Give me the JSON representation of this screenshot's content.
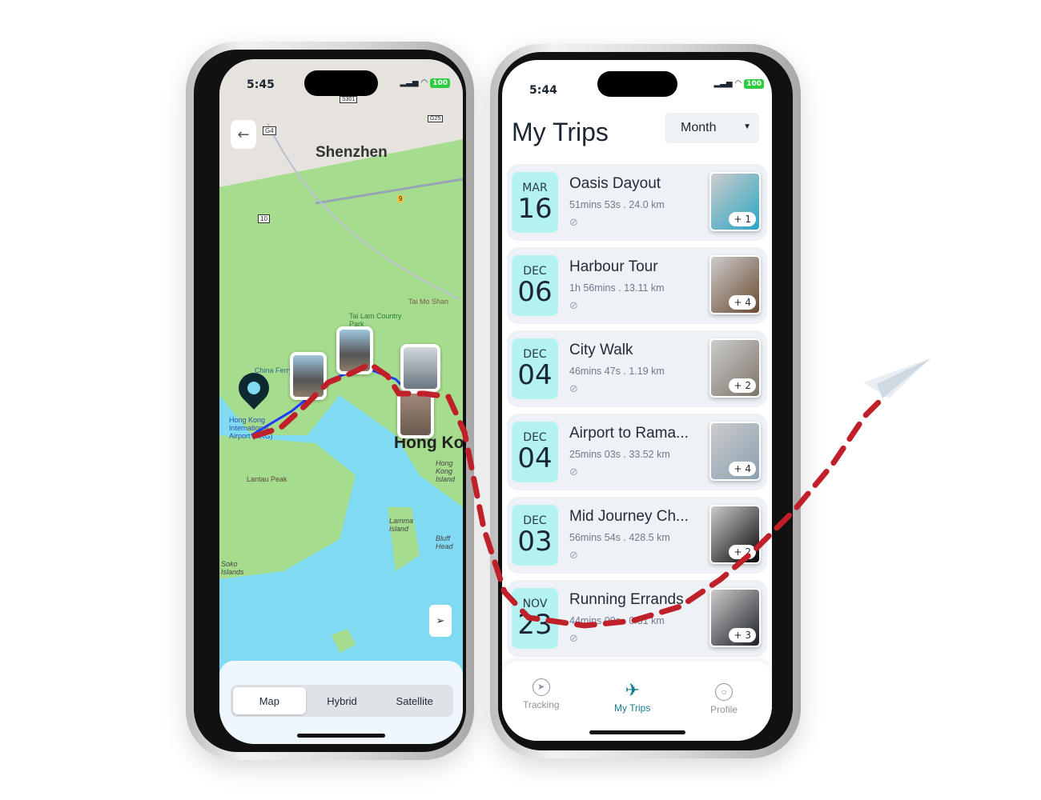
{
  "map_phone": {
    "time": "5:45",
    "battery": "100",
    "labels": {
      "city1": "Shenzhen",
      "city2": "Hong Kong",
      "airport": "Hong Kong International Airport (HKG)",
      "tai_mo_shan": "Tai Mo Shan",
      "tai_lam": "Tai Lam Country Park",
      "lantau": "Lantau Peak",
      "lamma": "Lamma Island",
      "soko": "Soko Islands",
      "hk_island": "Hong Kong Island",
      "bluff": "Bluff Head",
      "ferry": "China Ferry Terminal",
      "road_g4": "G4",
      "road_10": "10",
      "road_9": "9",
      "road_s301": "S301",
      "road_g25": "G25"
    },
    "map_types": [
      "Map",
      "Hybrid",
      "Satellite"
    ],
    "selected_map_type": "Map"
  },
  "trips_phone": {
    "time": "5:44",
    "battery": "100",
    "title": "My Trips",
    "filter": "Month",
    "trips": [
      {
        "month": "MAR",
        "day": "16",
        "title": "Oasis Dayout",
        "meta": "51mins 53s . 24.0 km",
        "extra": "+ 1",
        "color": "#2aa6c4"
      },
      {
        "month": "DEC",
        "day": "06",
        "title": "Harbour Tour",
        "meta": "1h 56mins . 13.11 km",
        "extra": "+ 4",
        "color": "#6a4a2e"
      },
      {
        "month": "DEC",
        "day": "04",
        "title": "City Walk",
        "meta": "46mins 47s . 1.19 km",
        "extra": "+ 2",
        "color": "#7d7468"
      },
      {
        "month": "DEC",
        "day": "04",
        "title": "Airport to Rama...",
        "meta": "25mins 03s . 33.52 km",
        "extra": "+ 4",
        "color": "#8aa0b0"
      },
      {
        "month": "DEC",
        "day": "03",
        "title": "Mid Journey Ch...",
        "meta": "56mins 54s . 428.5 km",
        "extra": "+ 2",
        "color": "#050505"
      },
      {
        "month": "NOV",
        "day": "23",
        "title": "Running Errands",
        "meta": "44mins 09s . 0.31 km",
        "extra": "+ 3",
        "color": "#1c2026"
      }
    ],
    "tabs": [
      {
        "label": "Tracking"
      },
      {
        "label": "My Trips"
      },
      {
        "label": "Profile"
      }
    ],
    "active_tab": "My Trips",
    "accent": "#147d8c"
  },
  "route_color": "#c0202a"
}
